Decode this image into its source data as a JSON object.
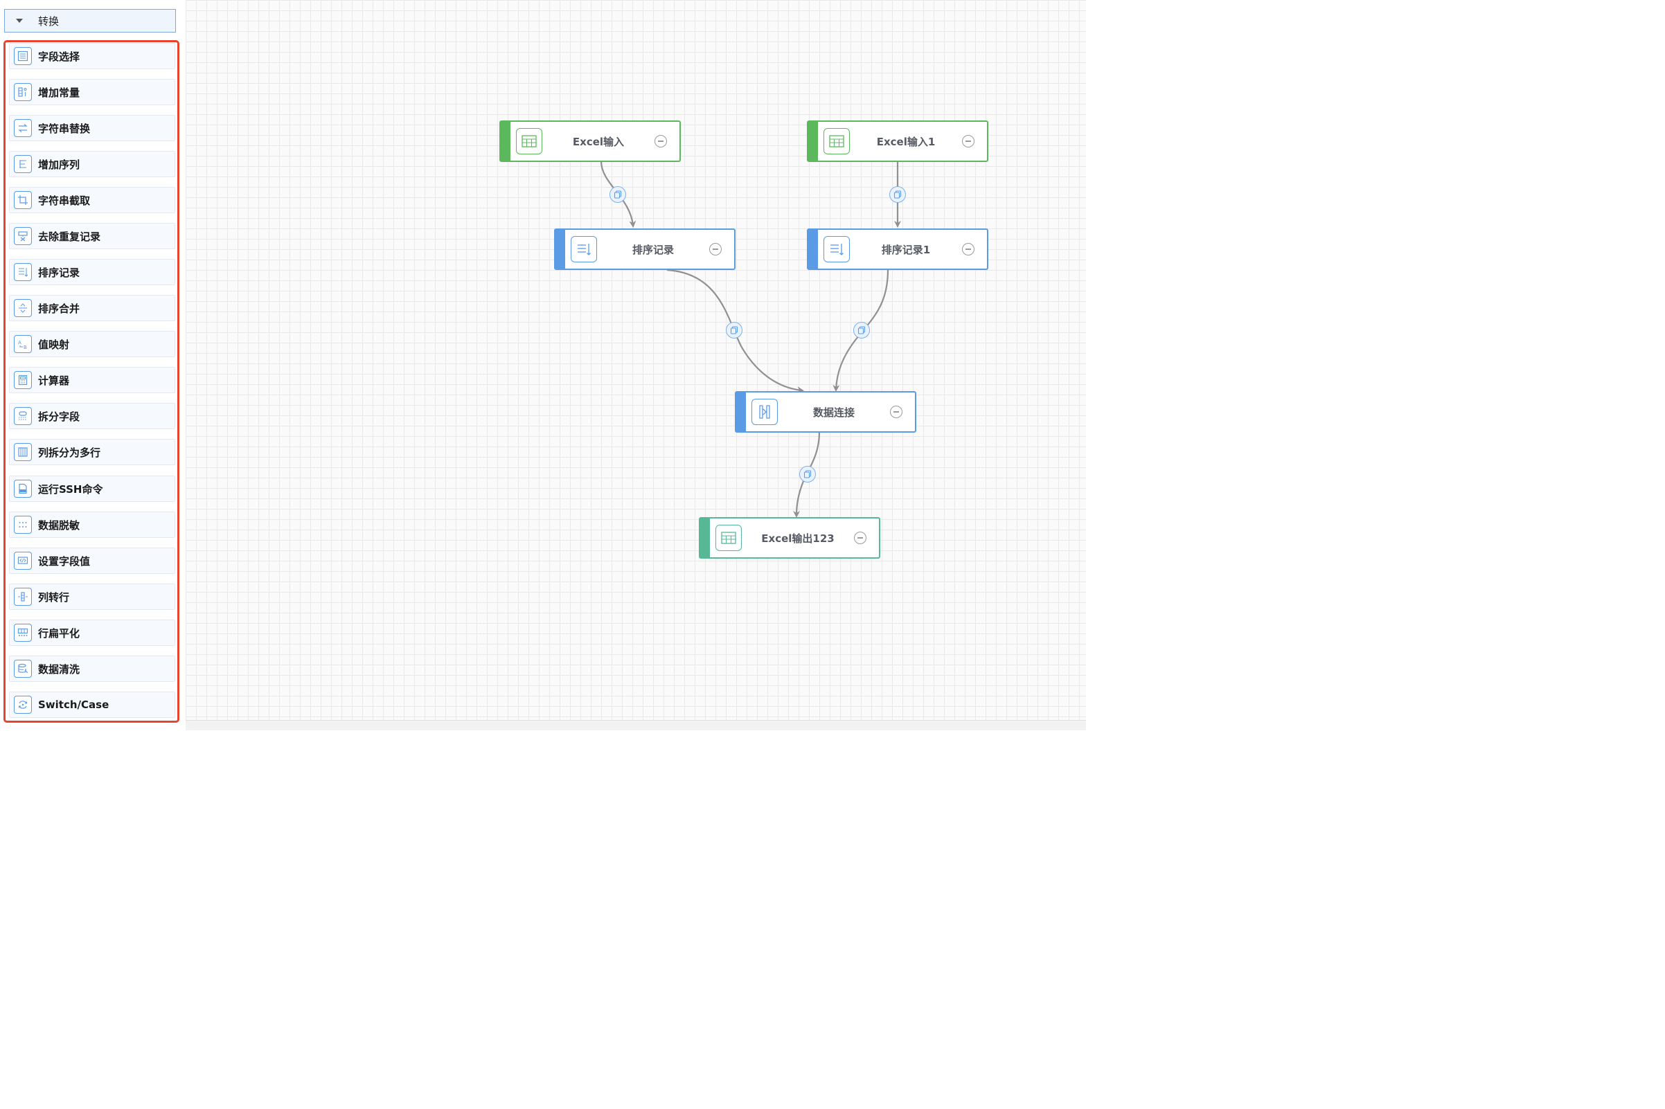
{
  "sidebar": {
    "category": {
      "title": "转换"
    },
    "steps": [
      {
        "label": "字段选择",
        "icon": "field-select-icon"
      },
      {
        "label": "增加常量",
        "icon": "add-constant-icon"
      },
      {
        "label": "字符串替换",
        "icon": "string-replace-icon"
      },
      {
        "label": "增加序列",
        "icon": "add-sequence-icon"
      },
      {
        "label": "字符串截取",
        "icon": "string-cut-icon"
      },
      {
        "label": "去除重复记录",
        "icon": "dedupe-icon"
      },
      {
        "label": "排序记录",
        "icon": "sort-icon"
      },
      {
        "label": "排序合并",
        "icon": "sort-merge-icon"
      },
      {
        "label": "值映射",
        "icon": "value-mapping-icon"
      },
      {
        "label": "计算器",
        "icon": "calculator-icon"
      },
      {
        "label": "拆分字段",
        "icon": "split-field-icon"
      },
      {
        "label": "列拆分为多行",
        "icon": "split-rows-icon"
      },
      {
        "label": "运行SSH命令",
        "icon": "ssh-icon"
      },
      {
        "label": "数据脱敏",
        "icon": "masking-icon"
      },
      {
        "label": "设置字段值",
        "icon": "set-field-icon"
      },
      {
        "label": "列转行",
        "icon": "column-to-row-icon"
      },
      {
        "label": "行扁平化",
        "icon": "flatten-icon"
      },
      {
        "label": "数据清洗",
        "icon": "data-clean-icon"
      },
      {
        "label": "Switch/Case",
        "icon": "switch-case-icon"
      }
    ]
  },
  "canvas": {
    "nodes": [
      {
        "id": "excel-input",
        "label": "Excel输入",
        "kind": "input",
        "icon": "table-icon"
      },
      {
        "id": "excel-input-1",
        "label": "Excel输入1",
        "kind": "input",
        "icon": "table-icon"
      },
      {
        "id": "sort-records",
        "label": "排序记录",
        "kind": "process",
        "icon": "sort-icon"
      },
      {
        "id": "sort-records-1",
        "label": "排序记录1",
        "kind": "process",
        "icon": "sort-icon"
      },
      {
        "id": "data-join",
        "label": "数据连接",
        "kind": "process",
        "icon": "join-icon"
      },
      {
        "id": "excel-output",
        "label": "Excel输出123",
        "kind": "output",
        "icon": "table-icon"
      }
    ],
    "hops": [
      {
        "from": "excel-input",
        "to": "sort-records"
      },
      {
        "from": "excel-input-1",
        "to": "sort-records-1"
      },
      {
        "from": "sort-records",
        "to": "data-join"
      },
      {
        "from": "sort-records-1",
        "to": "data-join"
      },
      {
        "from": "data-join",
        "to": "excel-output"
      }
    ]
  },
  "colors": {
    "input_accent": "#5cb85c",
    "process_accent": "#5b9be6",
    "output_accent": "#56b895",
    "highlight_border": "#e8432f"
  }
}
